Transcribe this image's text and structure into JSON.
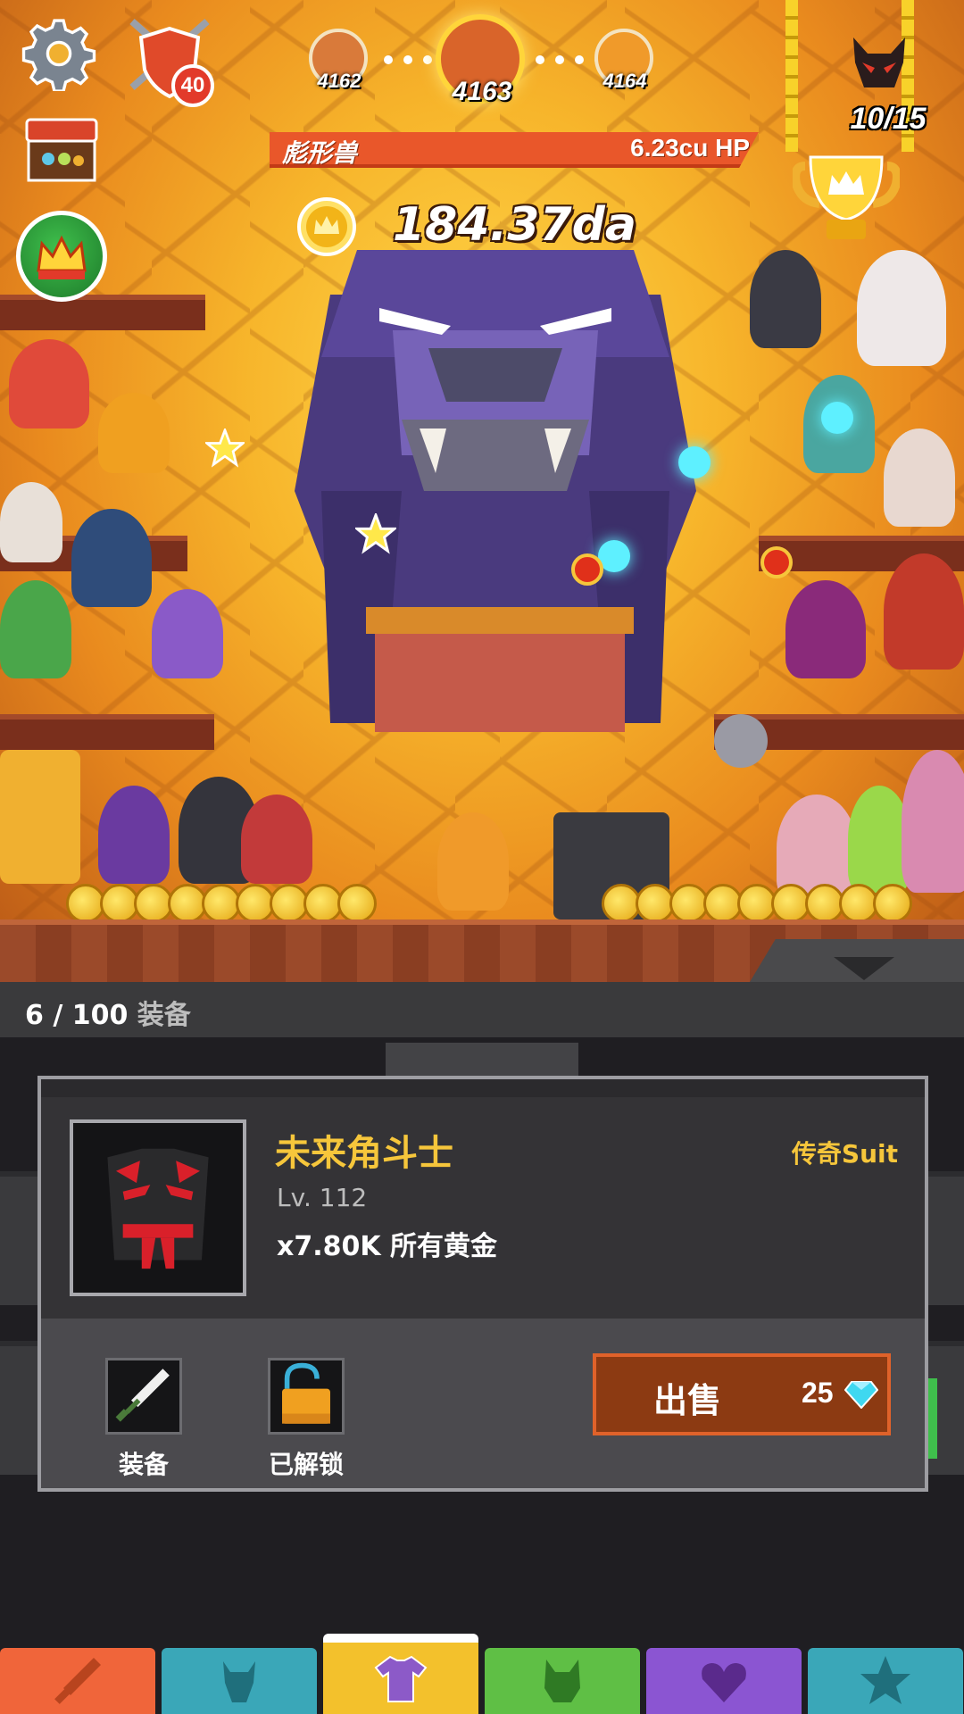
{
  "hud": {
    "shield_level": "40",
    "stages": {
      "previous": "4162",
      "current": "4163",
      "next": "4164"
    },
    "boss": {
      "name": "彪形兽",
      "hp": "6.23cu HP"
    },
    "gold": "184.37da",
    "boss_progress": "10/15"
  },
  "equipment": {
    "count": "6 / 100",
    "count_suffix": "装备"
  },
  "item": {
    "name": "未来角斗士",
    "rarity": "传奇Suit",
    "level": "Lv. 112",
    "effect": "x7.80K 所有黄金",
    "equip_label": "装备",
    "lock_label": "已解锁",
    "sell_label": "出售",
    "sell_price": "25"
  },
  "colors": {
    "accent_gold": "#f6c63b",
    "hp_bar": "#e9572a",
    "sell_button": "#8c3a12"
  },
  "nav": {
    "tabs": [
      {
        "icon": "sword-icon",
        "color": "#f0653a"
      },
      {
        "icon": "hero-icon",
        "color": "#3aa7b8"
      },
      {
        "icon": "shirt-icon",
        "color": "#f3c12c",
        "active": true
      },
      {
        "icon": "pet-icon",
        "color": "#5fbf45"
      },
      {
        "icon": "heart-shield-icon",
        "color": "#8b55d2"
      },
      {
        "icon": "star-icon",
        "color": "#3aa7b8"
      }
    ]
  }
}
